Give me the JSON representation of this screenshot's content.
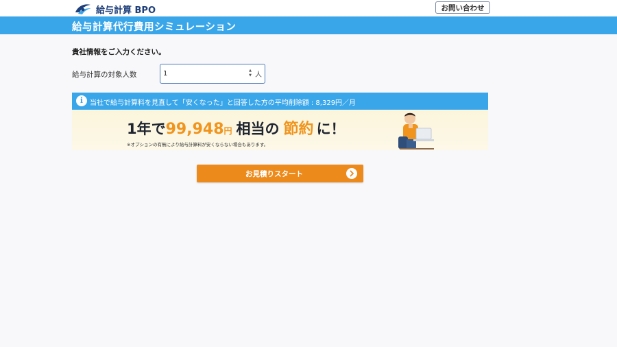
{
  "header": {
    "logo_text": "給与計算 BPO",
    "contact_label": "お問い合わせ"
  },
  "title_bar": {
    "title": "給与計算代行費用シミュレーション"
  },
  "form": {
    "intro": "貴社情報をご入力ください。",
    "count_label": "給与計算の対象人数",
    "count_value": "1",
    "count_unit": "人"
  },
  "info": {
    "text": "当社で給与計算料を見直して「安くなった」と回答した方の平均削除額 : 8,329円／月"
  },
  "banner": {
    "prefix": "1年で",
    "amount": "99,948",
    "yen": "円",
    "mid": "相当の",
    "highlight": "節約",
    "suffix": "に！",
    "note": "※オプションの有無により給与計算料が安くならない場合もあります。"
  },
  "cta": {
    "start_label": "お見積りスタート"
  },
  "colors": {
    "accent_blue": "#3aa6ea",
    "accent_orange": "#ec8a1c",
    "brand_navy": "#1f3f7a"
  }
}
